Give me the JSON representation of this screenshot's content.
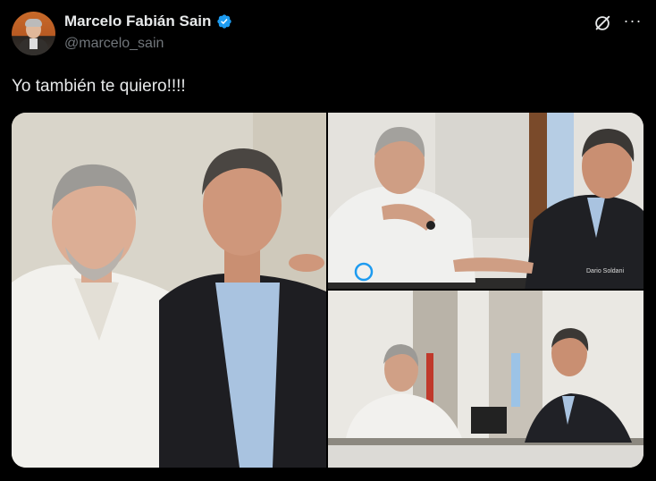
{
  "author": {
    "display_name": "Marcelo Fabián Sain",
    "handle": "@marcelo_sain",
    "verified": true,
    "avatar": "avatar-photo"
  },
  "tweet": {
    "text": "Yo también te quiero!!!!"
  },
  "header_actions": {
    "grok_icon": "grok-icon",
    "more_icon": "more-icon",
    "more_label": "···"
  },
  "media": {
    "photo_count": 3,
    "photo_2_credit": "Dario Soldani"
  },
  "colors": {
    "background": "#000000",
    "text": "#e7e9ea",
    "secondary": "#71767b",
    "verified": "#1d9bf0"
  }
}
